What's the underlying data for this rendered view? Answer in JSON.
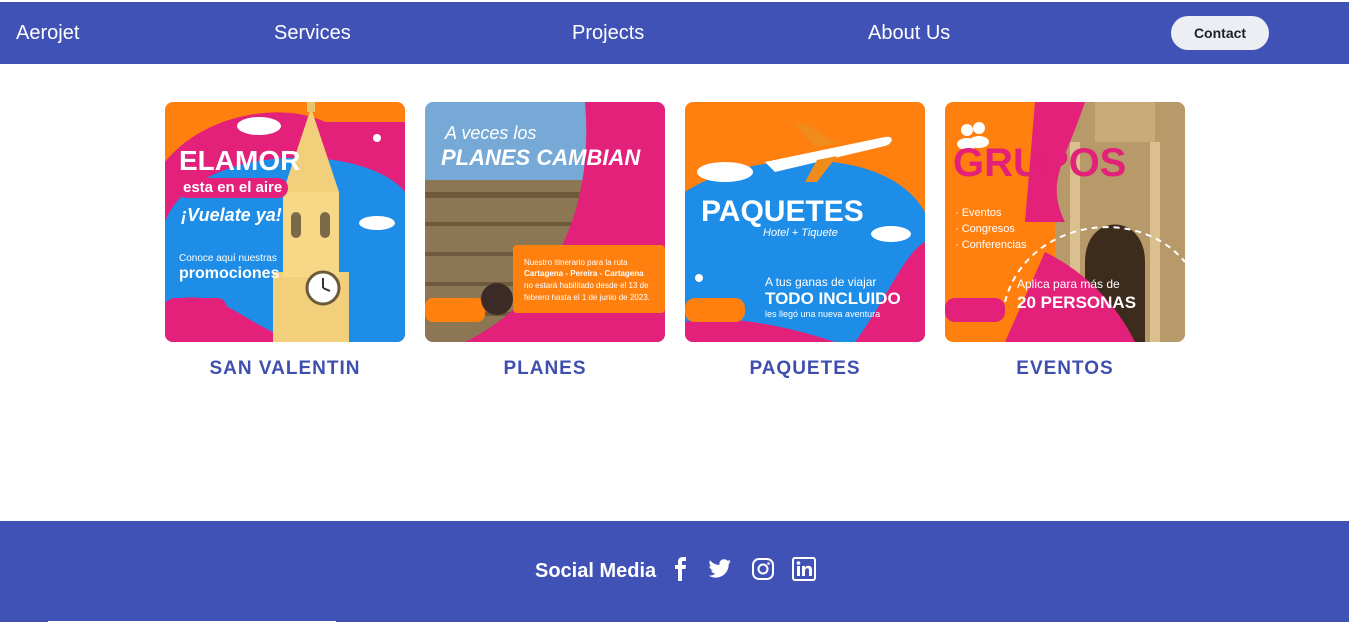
{
  "header": {
    "brand": "Aerojet",
    "nav": {
      "services": "Services",
      "projects": "Projects",
      "about": "About Us"
    },
    "contact_label": "Contact"
  },
  "cards": [
    {
      "title": "SAN VALENTIN",
      "image_text": {
        "line1": "ELAMOR",
        "line2": "esta en el aire",
        "line3": "¡Vuelate ya!",
        "line4": "Conoce aquí nuestras",
        "line5": "promociones"
      }
    },
    {
      "title": "PLANES",
      "image_text": {
        "line1": "A veces los",
        "line2": "PLANES CAMBIAN",
        "line3": "Nuestro itinerario para la ruta",
        "line4": "Cartagena - Pereira - Cartagena",
        "line5": "no estará habilitado desde el 13 de",
        "line6": "febrero hasta el 1 de junio de 2023."
      }
    },
    {
      "title": "PAQUETES",
      "image_text": {
        "line1": "PAQUETES",
        "line2": "Hotel + Tiquete",
        "line3": "A tus ganas de viajar",
        "line4": "TODO INCLUIDO",
        "line5": "les llegó una nueva aventura"
      }
    },
    {
      "title": "EVENTOS",
      "image_text": {
        "line1": "GRUPOS",
        "line2": "· Eventos",
        "line3": "· Congresos",
        "line4": "· Conferencias",
        "line5": "Aplica para más de",
        "line6": "20 PERSONAS"
      }
    }
  ],
  "footer": {
    "social_label": "Social Media",
    "icons": [
      "facebook-icon",
      "twitter-icon",
      "instagram-icon",
      "linkedin-icon"
    ]
  },
  "colors": {
    "primary": "#4152b7",
    "orange": "#ff7f0f",
    "pink": "#e3207a",
    "blue": "#1e8de8"
  }
}
